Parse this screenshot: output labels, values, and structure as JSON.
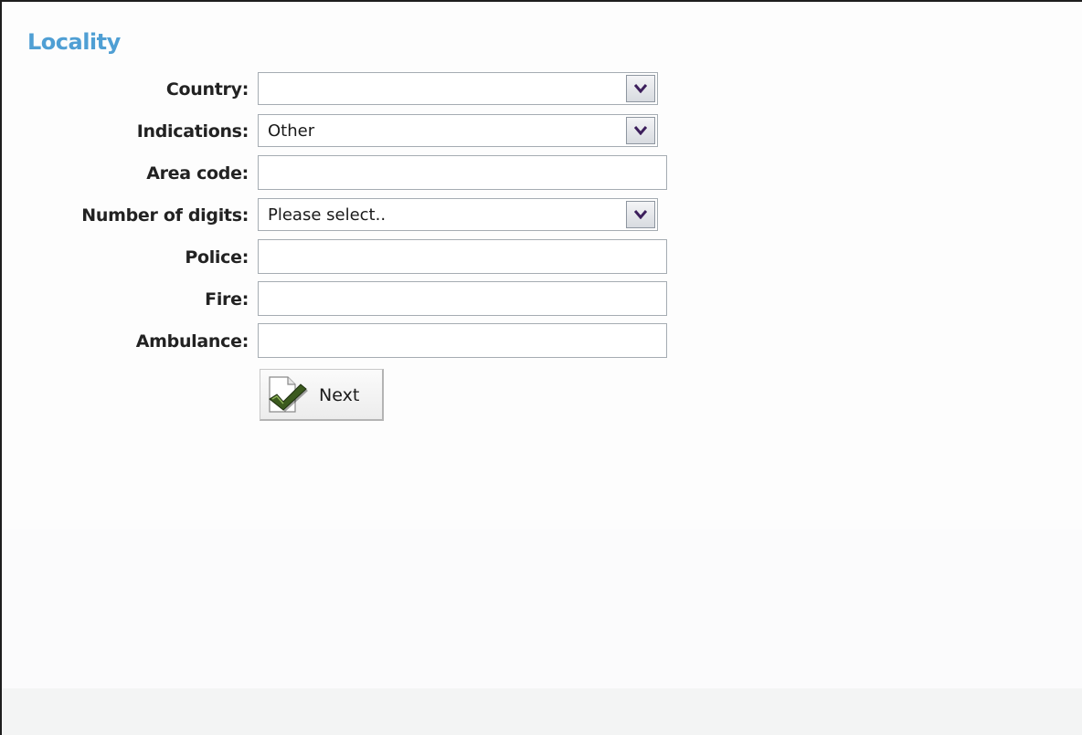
{
  "form": {
    "title": "Locality",
    "fields": {
      "country": {
        "label": "Country:",
        "value": ""
      },
      "indications": {
        "label": "Indications:",
        "value": "Other"
      },
      "area_code": {
        "label": "Area code:",
        "value": ""
      },
      "number_of_digits": {
        "label": "Number of digits:",
        "value": "Please select.."
      },
      "police": {
        "label": "Police:",
        "value": ""
      },
      "fire": {
        "label": "Fire:",
        "value": ""
      },
      "ambulance": {
        "label": "Ambulance:",
        "value": ""
      }
    },
    "next_button": {
      "label": "Next",
      "icon": "document-check-icon"
    }
  },
  "colors": {
    "title": "#4f9fd4",
    "label": "#222222",
    "field_border": "#a5acb2",
    "check_green": "#3b5a1e",
    "dropdown_arrow": "#3d1f5c"
  }
}
